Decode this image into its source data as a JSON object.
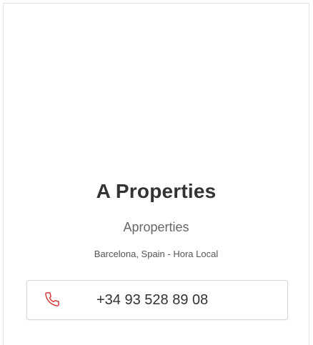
{
  "profile": {
    "name": "A Properties",
    "alias": "Aproperties",
    "location": "Barcelona, Spain - Hora Local"
  },
  "contact": {
    "phone_icon": "phone-icon",
    "phone_number": "+34 93 528 89 08",
    "icon_color": "#d23a3a"
  }
}
